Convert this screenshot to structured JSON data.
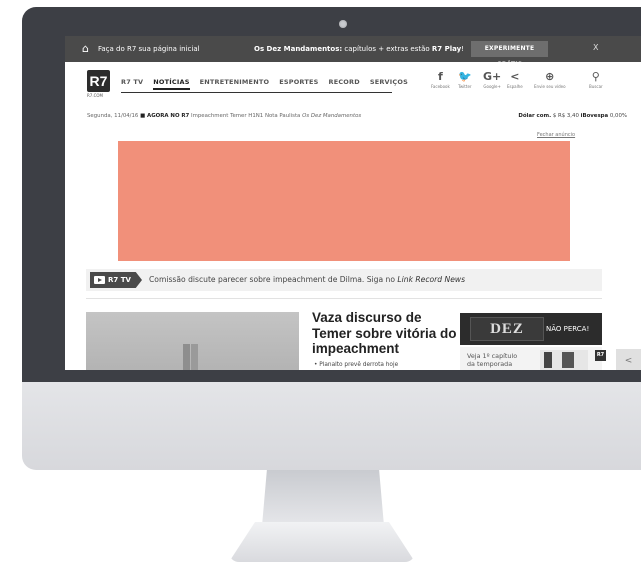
{
  "promo_bar": {
    "home_text": "Faça do R7 sua página inicial",
    "message_bold": "Os Dez Mandamentos:",
    "message_mid": " capítulos + extras estão ",
    "message_bold2": "R7 Play",
    "message_end": "!",
    "cta": "EXPERIMENTE GRÁTIS",
    "close": "X"
  },
  "header": {
    "logo": "R7",
    "logo_sub": "R7.COM",
    "nav": [
      "R7 TV",
      "NOTÍCIAS",
      "ENTRETENIMENTO",
      "ESPORTES",
      "RECORD",
      "SERVIÇOS"
    ],
    "share": [
      {
        "icon": "f",
        "label": "Facebook"
      },
      {
        "icon": "🐦",
        "label": "Twitter"
      },
      {
        "icon": "G+",
        "label": "Google+"
      },
      {
        "icon": "<",
        "label": "Espalhe"
      },
      {
        "icon": "⊕",
        "label": "Envie seu vídeo"
      },
      {
        "icon": "⚲",
        "label": "Buscar"
      }
    ]
  },
  "subbar": {
    "date": "Segunda, 11/04/16",
    "now_label": "■ AGORA NO R7",
    "links": "Impeachment   Temer   H1N1   Nota Paulista",
    "italic_link": "Os Dez Mandamentos",
    "dollar_label": "Dólar com.",
    "dollar_value": "$ R$ 3,40",
    "ibovespa_label": "iBovespa",
    "ibovespa_value": "0,00%",
    "close_ad": "Fechar anúncio"
  },
  "ticker": {
    "tag": "R7 TV",
    "text": "Comissão discute parecer sobre impeachment de Dilma. Siga no ",
    "italic": "Link Record News"
  },
  "main": {
    "headline": "Vaza discurso de Temer sobre vitória do impeachment",
    "bullet": "•  Planalto prevê derrota hoje"
  },
  "side": {
    "dez_logo": "DEZ",
    "dez_cta": "NÃO PERCA!",
    "episode": "Veja 1º capítulo da temporada",
    "mini_logo": "R7",
    "arrow": "<"
  },
  "colors": {
    "ad": "#f1907a",
    "bezel": "#3d3f45",
    "promo": "#4a4a4a"
  }
}
